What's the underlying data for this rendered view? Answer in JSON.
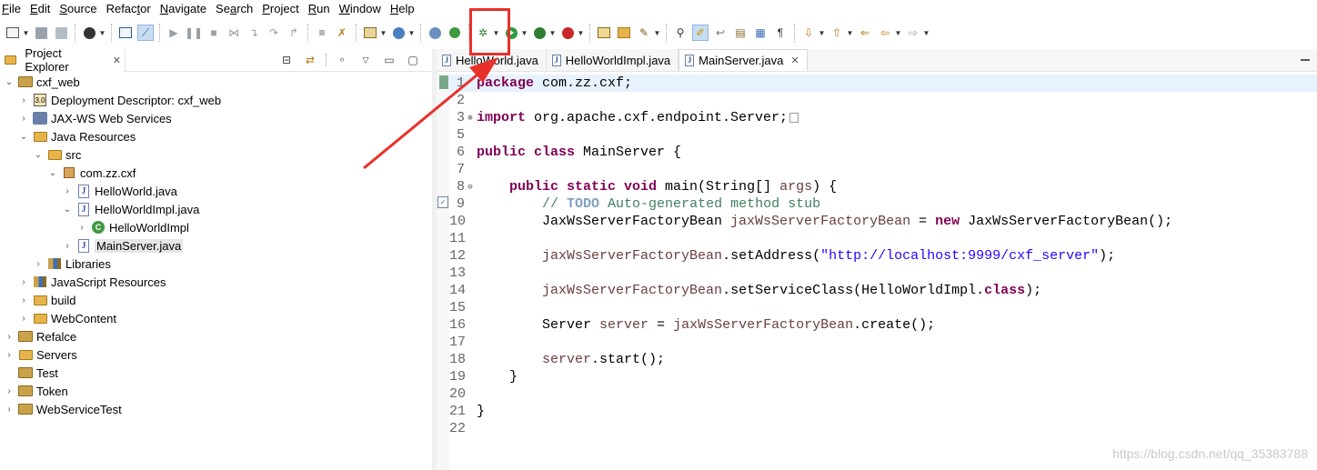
{
  "menu": [
    {
      "pre": "",
      "mn": "F",
      "post": "ile"
    },
    {
      "pre": "",
      "mn": "E",
      "post": "dit"
    },
    {
      "pre": "",
      "mn": "S",
      "post": "ource"
    },
    {
      "pre": "Refac",
      "mn": "t",
      "post": "or"
    },
    {
      "pre": "",
      "mn": "N",
      "post": "avigate"
    },
    {
      "pre": "Se",
      "mn": "a",
      "post": "rch"
    },
    {
      "pre": "",
      "mn": "P",
      "post": "roject"
    },
    {
      "pre": "",
      "mn": "R",
      "post": "un"
    },
    {
      "pre": "",
      "mn": "W",
      "post": "indow"
    },
    {
      "pre": "",
      "mn": "H",
      "post": "elp"
    }
  ],
  "explorer": {
    "title": "Project Explorer",
    "close": "✕",
    "tree": [
      {
        "label": "cxf_web",
        "twisty": "⌄",
        "icon": "project"
      },
      {
        "label": "Deployment Descriptor: cxf_web",
        "twisty": "›",
        "icon": "descriptor"
      },
      {
        "label": "JAX-WS Web Services",
        "twisty": "›",
        "icon": "webservice"
      },
      {
        "label": "Java Resources",
        "twisty": "⌄",
        "icon": "folder"
      },
      {
        "label": "src",
        "twisty": "⌄",
        "icon": "folder"
      },
      {
        "label": "com.zz.cxf",
        "twisty": "⌄",
        "icon": "package"
      },
      {
        "label": "HelloWorld.java",
        "twisty": "›",
        "icon": "java"
      },
      {
        "label": "HelloWorldImpl.java",
        "twisty": "⌄",
        "icon": "java"
      },
      {
        "label": "HelloWorldImpl",
        "twisty": "›",
        "icon": "class"
      },
      {
        "label": "MainServer.java",
        "twisty": "›",
        "icon": "java"
      },
      {
        "label": "Libraries",
        "twisty": "›",
        "icon": "library"
      },
      {
        "label": "JavaScript Resources",
        "twisty": "›",
        "icon": "library"
      },
      {
        "label": "build",
        "twisty": "›",
        "icon": "folder"
      },
      {
        "label": "WebContent",
        "twisty": "›",
        "icon": "folder"
      },
      {
        "label": "Refalce",
        "twisty": "›",
        "icon": "project"
      },
      {
        "label": "Servers",
        "twisty": "›",
        "icon": "folder"
      },
      {
        "label": "Test",
        "twisty": "",
        "icon": "project"
      },
      {
        "label": "Token",
        "twisty": "›",
        "icon": "project"
      },
      {
        "label": "WebServiceTest",
        "twisty": "›",
        "icon": "project"
      }
    ]
  },
  "editor": {
    "tabs": [
      {
        "label": "HelloWorld.java"
      },
      {
        "label": "HelloWorldImpl.java"
      },
      {
        "label": "MainServer.java",
        "close": "✕"
      }
    ],
    "lines": [
      {
        "n": "1",
        "fold": "",
        "code": [
          [
            "kw",
            "package"
          ],
          [
            "",
            " com.zz.cxf;"
          ]
        ]
      },
      {
        "n": "2",
        "fold": "",
        "code": []
      },
      {
        "n": "3",
        "fold": "⊕",
        "code": [
          [
            "kw",
            "import"
          ],
          [
            "",
            " org.apache.cxf.endpoint.Server;"
          ]
        ]
      },
      {
        "n": "5",
        "fold": "",
        "code": []
      },
      {
        "n": "6",
        "fold": "",
        "code": [
          [
            "kw",
            "public class"
          ],
          [
            "",
            " MainServer {"
          ]
        ]
      },
      {
        "n": "7",
        "fold": "",
        "code": []
      },
      {
        "n": "8",
        "fold": "⊖",
        "code": [
          [
            "",
            "    "
          ],
          [
            "kw",
            "public static void"
          ],
          [
            "",
            " main(String[] "
          ],
          [
            "var",
            "args"
          ],
          [
            "",
            ") {"
          ]
        ]
      },
      {
        "n": "9",
        "fold": "",
        "code": [
          [
            "",
            "        "
          ],
          [
            "cm",
            "// "
          ],
          [
            "todo",
            "TODO"
          ],
          [
            "cm",
            " Auto-generated method stub"
          ]
        ]
      },
      {
        "n": "10",
        "fold": "",
        "code": [
          [
            "",
            "        JaxWsServerFactoryBean "
          ],
          [
            "var",
            "jaxWsServerFactoryBean"
          ],
          [
            "",
            " = "
          ],
          [
            "kw",
            "new"
          ],
          [
            "",
            " JaxWsServerFactoryBean();"
          ]
        ]
      },
      {
        "n": "11",
        "fold": "",
        "code": []
      },
      {
        "n": "12",
        "fold": "",
        "code": [
          [
            "",
            "        "
          ],
          [
            "var",
            "jaxWsServerFactoryBean"
          ],
          [
            "",
            ".setAddress("
          ],
          [
            "str",
            "\"http://localhost:9999/cxf_server\""
          ],
          [
            "",
            ");"
          ]
        ]
      },
      {
        "n": "13",
        "fold": "",
        "code": []
      },
      {
        "n": "14",
        "fold": "",
        "code": [
          [
            "",
            "        "
          ],
          [
            "var",
            "jaxWsServerFactoryBean"
          ],
          [
            "",
            ".setServiceClass(HelloWorldImpl."
          ],
          [
            "kw",
            "class"
          ],
          [
            "",
            ");"
          ]
        ]
      },
      {
        "n": "15",
        "fold": "",
        "code": []
      },
      {
        "n": "16",
        "fold": "",
        "code": [
          [
            "",
            "        Server "
          ],
          [
            "var",
            "server"
          ],
          [
            "",
            " = "
          ],
          [
            "var",
            "jaxWsServerFactoryBean"
          ],
          [
            "",
            ".create();"
          ]
        ]
      },
      {
        "n": "17",
        "fold": "",
        "code": []
      },
      {
        "n": "18",
        "fold": "",
        "code": [
          [
            "",
            "        "
          ],
          [
            "var",
            "server"
          ],
          [
            "",
            ".start();"
          ]
        ]
      },
      {
        "n": "19",
        "fold": "",
        "code": [
          [
            "",
            "    }"
          ]
        ]
      },
      {
        "n": "20",
        "fold": "",
        "code": []
      },
      {
        "n": "21",
        "fold": "",
        "code": [
          [
            "",
            "}"
          ]
        ]
      },
      {
        "n": "22",
        "fold": "",
        "code": []
      }
    ]
  },
  "watermark": "https://blog.csdn.net/qq_35383788",
  "colors": {
    "keyword": "#7f0055",
    "string": "#2a00ff",
    "comment": "#3f7f5f",
    "annotation": "#e8302a"
  }
}
